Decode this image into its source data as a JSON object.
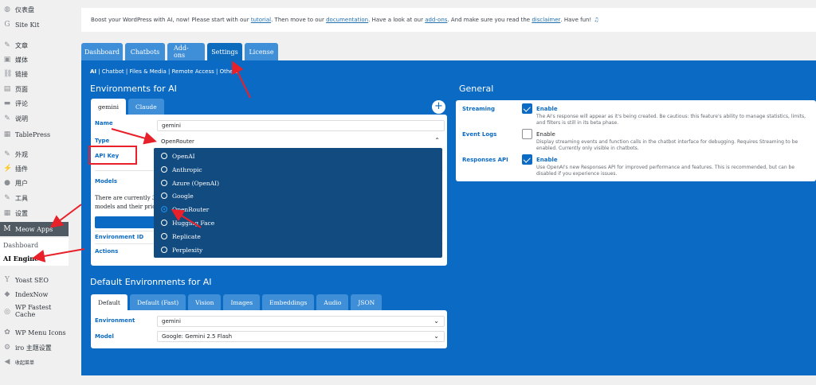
{
  "sidebar": {
    "items": [
      {
        "label": "仪表盘",
        "icon": "dashboard-icon",
        "glyph": "◍"
      },
      {
        "label": "Site Kit",
        "icon": "sitekit-icon",
        "glyph": "G"
      },
      {
        "label": "文章",
        "icon": "pin-icon",
        "glyph": "✎"
      },
      {
        "label": "媒体",
        "icon": "media-icon",
        "glyph": "▣"
      },
      {
        "label": "链接",
        "icon": "link-icon",
        "glyph": "⛓"
      },
      {
        "label": "页面",
        "icon": "page-icon",
        "glyph": "▤"
      },
      {
        "label": "评论",
        "icon": "comment-icon",
        "glyph": "▬"
      },
      {
        "label": "说明",
        "icon": "pin-icon",
        "glyph": "✎"
      },
      {
        "label": "TablePress",
        "icon": "table-icon",
        "glyph": "▦"
      },
      {
        "label": "外观",
        "icon": "appearance-icon",
        "glyph": "✎"
      },
      {
        "label": "插件",
        "icon": "plugin-icon",
        "glyph": "⚡"
      },
      {
        "label": "用户",
        "icon": "user-icon",
        "glyph": "●"
      },
      {
        "label": "工具",
        "icon": "tool-icon",
        "glyph": "✎"
      },
      {
        "label": "设置",
        "icon": "settings-icon",
        "glyph": "▦"
      },
      {
        "label": "Meow Apps",
        "icon": "meow-icon",
        "glyph": "M"
      },
      {
        "label": "Yoast SEO",
        "icon": "yoast-icon",
        "glyph": "Y"
      },
      {
        "label": "IndexNow",
        "icon": "indexnow-icon",
        "glyph": "◆"
      },
      {
        "label": "WP Fastest Cache",
        "icon": "cache-icon",
        "glyph": "◎"
      },
      {
        "label": "WP Menu Icons",
        "icon": "menu-icons-icon",
        "glyph": "✿"
      },
      {
        "label": "iro 主题设置",
        "icon": "theme-icon",
        "glyph": "⚙"
      },
      {
        "label": "收起菜单",
        "icon": "collapse-icon",
        "glyph": "◀"
      }
    ],
    "submenu": {
      "dashboard": "Dashboard",
      "ai_engine": "AI Engine"
    }
  },
  "notice": {
    "p1": "Boost your WordPress with AI, now! Please start with our ",
    "l1": "tutorial",
    "p2": ". Then move to our ",
    "l2": "documentation",
    "p3": ". Have a look at our ",
    "l3": "add-ons",
    "p4": ". And make sure you read the ",
    "l4": "disclaimer",
    "p5": ". Have fun! ",
    "music": "♫"
  },
  "tabs": [
    "Dashboard",
    "Chatbots",
    "Add-ons",
    "Settings",
    "License"
  ],
  "active_tab": "Settings",
  "subnav": {
    "active": "AI",
    "rest": " | Chatbot | Files & Media | Remote Access | Others"
  },
  "environments": {
    "title": "Environments for AI",
    "tabs": [
      "gemini",
      "Claude"
    ],
    "add": "+",
    "name_label": "Name",
    "name_value": "gemini",
    "type_label": "Type",
    "type_value": "OpenRouter",
    "api_key_label": "API Key",
    "models_label": "Models",
    "models_text_1": "There are currently 3",
    "models_text_2": "models and their pric",
    "env_id_label": "Environment ID",
    "actions_label": "Actions"
  },
  "dropdown": {
    "options": [
      "OpenAI",
      "Anthropic",
      "Azure (OpenAI)",
      "Google",
      "OpenRouter",
      "Hugging Face",
      "Replicate",
      "Perplexity"
    ],
    "selected": "OpenRouter"
  },
  "default_env": {
    "title": "Default Environments for AI",
    "tabs": [
      "Default",
      "Default (Fast)",
      "Vision",
      "Images",
      "Embeddings",
      "Audio",
      "JSON"
    ],
    "environment_label": "Environment",
    "environment_value": "gemini",
    "model_label": "Model",
    "model_value": "Google: Gemini 2.5 Flash"
  },
  "general": {
    "title": "General",
    "streaming": {
      "label": "Streaming",
      "enable": "Enable",
      "checked": true,
      "desc": "The AI's response will appear as it's being created. Be cautious: this feature's ability to manage statistics, limits, and filters is still in its beta phase."
    },
    "event_logs": {
      "label": "Event Logs",
      "enable": "Enable",
      "checked": false,
      "desc": "Display streaming events and function calls in the chatbot interface for debugging. Requires Streaming to be enabled. Currently only visible in chatbots."
    },
    "responses_api": {
      "label": "Responses API",
      "enable": "Enable",
      "checked": true,
      "desc": "Use OpenAI's new Responses API for improved performance and features. This is recommended, but can be disabled if you experience issues."
    }
  },
  "colors": {
    "primary": "#0b6ac3",
    "annotation": "#e8202a",
    "dropdown": "#114b80"
  }
}
